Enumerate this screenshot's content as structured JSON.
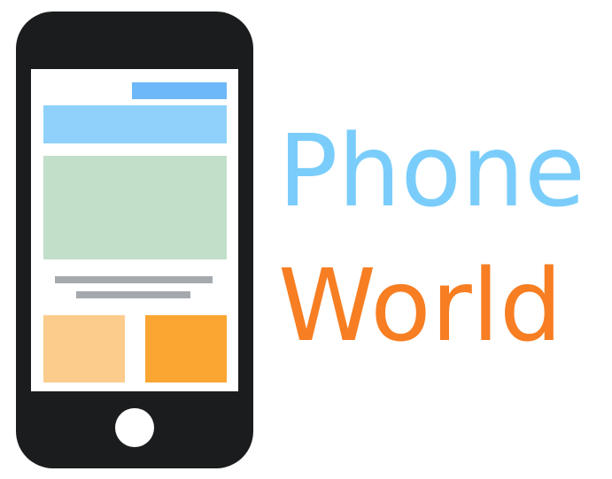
{
  "logo": {
    "line1": "Phone",
    "line2": "World"
  },
  "colors": {
    "phone_body": "#1a1c1d",
    "screen": "#ffffff",
    "screen_header_bar": "#6db8f8",
    "screen_banner": "#8fd1fb",
    "screen_hero_image": "#c2dfc9",
    "screen_text_lines": "#a5a9ad",
    "screen_card_left": "#fbcc8c",
    "screen_card_right": "#fba532",
    "home_button": "#ffffff",
    "line1_text": "#7acdfa",
    "line2_text": "#f77e22"
  },
  "icons": {
    "phone": "smartphone-icon",
    "home_button": "home-button-icon"
  }
}
